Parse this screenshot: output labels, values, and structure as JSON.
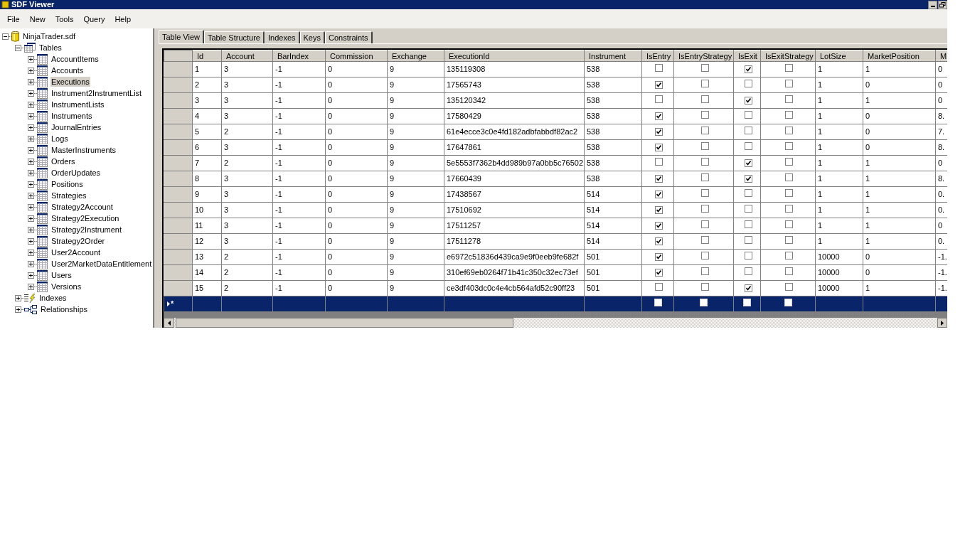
{
  "window": {
    "title": "SDF Viewer"
  },
  "menu": [
    "File",
    "New",
    "Tools",
    "Query",
    "Help"
  ],
  "tree": [
    {
      "label": "NinjaTrader.sdf",
      "kind": "database",
      "expanded": true,
      "selected": false,
      "children": [
        {
          "label": "Tables",
          "kind": "tables",
          "expanded": true,
          "selected": false,
          "children": [
            {
              "label": "AccountItems",
              "kind": "table",
              "expanded": false,
              "selected": false
            },
            {
              "label": "Accounts",
              "kind": "table",
              "expanded": false,
              "selected": false
            },
            {
              "label": "Executions",
              "kind": "table",
              "expanded": false,
              "selected": true
            },
            {
              "label": "Instrument2InstrumentList",
              "kind": "table",
              "expanded": false,
              "selected": false
            },
            {
              "label": "InstrumentLists",
              "kind": "table",
              "expanded": false,
              "selected": false
            },
            {
              "label": "Instruments",
              "kind": "table",
              "expanded": false,
              "selected": false
            },
            {
              "label": "JournalEntries",
              "kind": "table",
              "expanded": false,
              "selected": false
            },
            {
              "label": "Logs",
              "kind": "table",
              "expanded": false,
              "selected": false
            },
            {
              "label": "MasterInstruments",
              "kind": "table",
              "expanded": false,
              "selected": false
            },
            {
              "label": "Orders",
              "kind": "table",
              "expanded": false,
              "selected": false
            },
            {
              "label": "OrderUpdates",
              "kind": "table",
              "expanded": false,
              "selected": false
            },
            {
              "label": "Positions",
              "kind": "table",
              "expanded": false,
              "selected": false
            },
            {
              "label": "Strategies",
              "kind": "table",
              "expanded": false,
              "selected": false
            },
            {
              "label": "Strategy2Account",
              "kind": "table",
              "expanded": false,
              "selected": false
            },
            {
              "label": "Strategy2Execution",
              "kind": "table",
              "expanded": false,
              "selected": false
            },
            {
              "label": "Strategy2Instrument",
              "kind": "table",
              "expanded": false,
              "selected": false
            },
            {
              "label": "Strategy2Order",
              "kind": "table",
              "expanded": false,
              "selected": false
            },
            {
              "label": "User2Account",
              "kind": "table",
              "expanded": false,
              "selected": false
            },
            {
              "label": "User2MarketDataEntitlement",
              "kind": "table",
              "expanded": false,
              "selected": false
            },
            {
              "label": "Users",
              "kind": "table",
              "expanded": false,
              "selected": false
            },
            {
              "label": "Versions",
              "kind": "table",
              "expanded": false,
              "selected": false
            }
          ]
        },
        {
          "label": "Indexes",
          "kind": "indexes",
          "expanded": false,
          "selected": false
        },
        {
          "label": "Relationships",
          "kind": "relationships",
          "expanded": false,
          "selected": false
        }
      ]
    }
  ],
  "tabs": [
    {
      "label": "Table View",
      "selected": true
    },
    {
      "label": "Table Structure",
      "selected": false
    },
    {
      "label": "Indexes",
      "selected": false
    },
    {
      "label": "Keys",
      "selected": false
    },
    {
      "label": "Constraints",
      "selected": false
    }
  ],
  "table": {
    "columns": [
      {
        "label": "Id",
        "kind": "text"
      },
      {
        "label": "Account",
        "kind": "text"
      },
      {
        "label": "BarIndex",
        "kind": "text"
      },
      {
        "label": "Commission",
        "kind": "text"
      },
      {
        "label": "Exchange",
        "kind": "text"
      },
      {
        "label": "ExecutionId",
        "kind": "text"
      },
      {
        "label": "Instrument",
        "kind": "text"
      },
      {
        "label": "IsEntry",
        "kind": "check"
      },
      {
        "label": "IsEntryStrategy",
        "kind": "check"
      },
      {
        "label": "IsExit",
        "kind": "check"
      },
      {
        "label": "IsExitStrategy",
        "kind": "check"
      },
      {
        "label": "LotSize",
        "kind": "text"
      },
      {
        "label": "MarketPosition",
        "kind": "text"
      },
      {
        "label": "M",
        "kind": "text"
      }
    ],
    "rows": [
      {
        "cells": [
          "1",
          "3",
          "-1",
          "0",
          "9",
          "135119308",
          "538",
          false,
          false,
          true,
          false,
          "1",
          "1",
          "0"
        ]
      },
      {
        "cells": [
          "2",
          "3",
          "-1",
          "0",
          "9",
          "17565743",
          "538",
          true,
          false,
          false,
          false,
          "1",
          "0",
          "0"
        ]
      },
      {
        "cells": [
          "3",
          "3",
          "-1",
          "0",
          "9",
          "135120342",
          "538",
          false,
          false,
          true,
          false,
          "1",
          "1",
          "0"
        ]
      },
      {
        "cells": [
          "4",
          "3",
          "-1",
          "0",
          "9",
          "17580429",
          "538",
          true,
          false,
          false,
          false,
          "1",
          "0",
          "8."
        ]
      },
      {
        "cells": [
          "5",
          "2",
          "-1",
          "0",
          "9",
          "61e4ecce3c0e4fd182adbfabbdf82ac2",
          "538",
          true,
          false,
          false,
          false,
          "1",
          "0",
          "7."
        ]
      },
      {
        "cells": [
          "6",
          "3",
          "-1",
          "0",
          "9",
          "17647861",
          "538",
          true,
          false,
          false,
          false,
          "1",
          "0",
          "8."
        ]
      },
      {
        "cells": [
          "7",
          "2",
          "-1",
          "0",
          "9",
          "5e5553f7362b4dd989b97a0bb5c76502",
          "538",
          false,
          false,
          true,
          false,
          "1",
          "1",
          "0"
        ]
      },
      {
        "cells": [
          "8",
          "3",
          "-1",
          "0",
          "9",
          "17660439",
          "538",
          true,
          false,
          true,
          false,
          "1",
          "1",
          "8."
        ]
      },
      {
        "cells": [
          "9",
          "3",
          "-1",
          "0",
          "9",
          "17438567",
          "514",
          true,
          false,
          false,
          false,
          "1",
          "1",
          "0."
        ]
      },
      {
        "cells": [
          "10",
          "3",
          "-1",
          "0",
          "9",
          "17510692",
          "514",
          true,
          false,
          false,
          false,
          "1",
          "1",
          "0."
        ]
      },
      {
        "cells": [
          "11",
          "3",
          "-1",
          "0",
          "9",
          "17511257",
          "514",
          true,
          false,
          false,
          false,
          "1",
          "1",
          "0"
        ]
      },
      {
        "cells": [
          "12",
          "3",
          "-1",
          "0",
          "9",
          "17511278",
          "514",
          true,
          false,
          false,
          false,
          "1",
          "1",
          "0."
        ]
      },
      {
        "cells": [
          "13",
          "2",
          "-1",
          "0",
          "9",
          "e6972c51836d439ca9e9f0eeb9fe682f",
          "501",
          true,
          false,
          false,
          false,
          "10000",
          "0",
          "-1."
        ]
      },
      {
        "cells": [
          "14",
          "2",
          "-1",
          "0",
          "9",
          "310ef69eb0264f71b41c350c32ec73ef",
          "501",
          true,
          false,
          false,
          false,
          "10000",
          "0",
          "-1."
        ]
      },
      {
        "cells": [
          "15",
          "2",
          "-1",
          "0",
          "9",
          "ce3df403dc0c4e4cb564afd52c90ff23",
          "501",
          false,
          false,
          true,
          false,
          "10000",
          "1",
          "-1."
        ]
      }
    ],
    "new_row": {
      "marker": "*",
      "cells": [
        false,
        false,
        false,
        false
      ]
    }
  }
}
